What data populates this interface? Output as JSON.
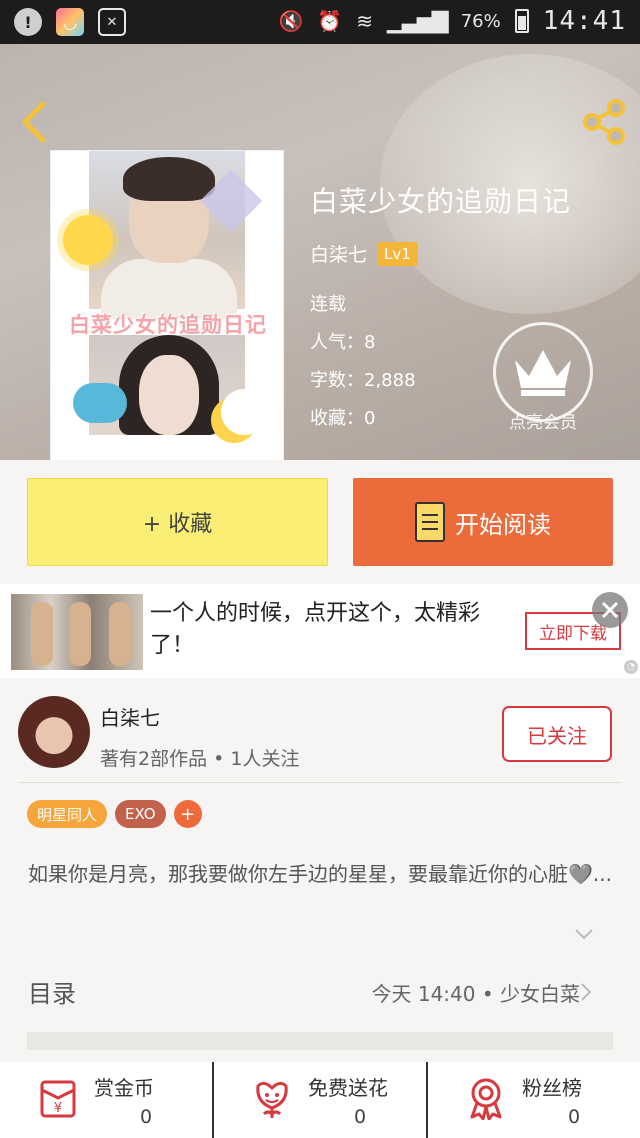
{
  "status_bar": {
    "battery": "76%",
    "time": "14:41"
  },
  "book": {
    "title": "白菜少女的追勋日记",
    "cover_title": "白菜少女的追勋日记",
    "author": "白柒七",
    "level": "Lv1",
    "status": "连载",
    "popularity_label": "人气：",
    "popularity": "8",
    "words_label": "字数：",
    "words": "2,888",
    "favorites_label": "收藏：",
    "favorites": "0",
    "vip_label": "点亮会员"
  },
  "actions": {
    "collect_label": "+ 收藏",
    "read_label": "开始阅读"
  },
  "ad": {
    "text": "一个人的时候，点开这个，太精彩了！",
    "button_label": "立即下载"
  },
  "author": {
    "name": "白柒七",
    "stats": "著有2部作品 • 1人关注",
    "follow_label": "已关注"
  },
  "tags": [
    "明星同人",
    "EXO",
    "+"
  ],
  "description": "如果你是月亮，那我要做你左手边的星星，要最靠近你的心脏🩶...",
  "toc": {
    "label": "目录",
    "latest": "今天 14:40 • 少女白菜"
  },
  "bottom_bar": [
    {
      "label": "赏金币",
      "count": "0",
      "icon": "coin-envelope-icon"
    },
    {
      "label": "免费送花",
      "count": "0",
      "icon": "flower-icon"
    },
    {
      "label": "粉丝榜",
      "count": "0",
      "icon": "ribbon-badge-icon"
    }
  ],
  "colors": {
    "accent_orange": "#ec6b3a",
    "collect_yellow": "#fbee74",
    "follow_red": "#d7393f",
    "level_gold": "#f4b63a"
  }
}
